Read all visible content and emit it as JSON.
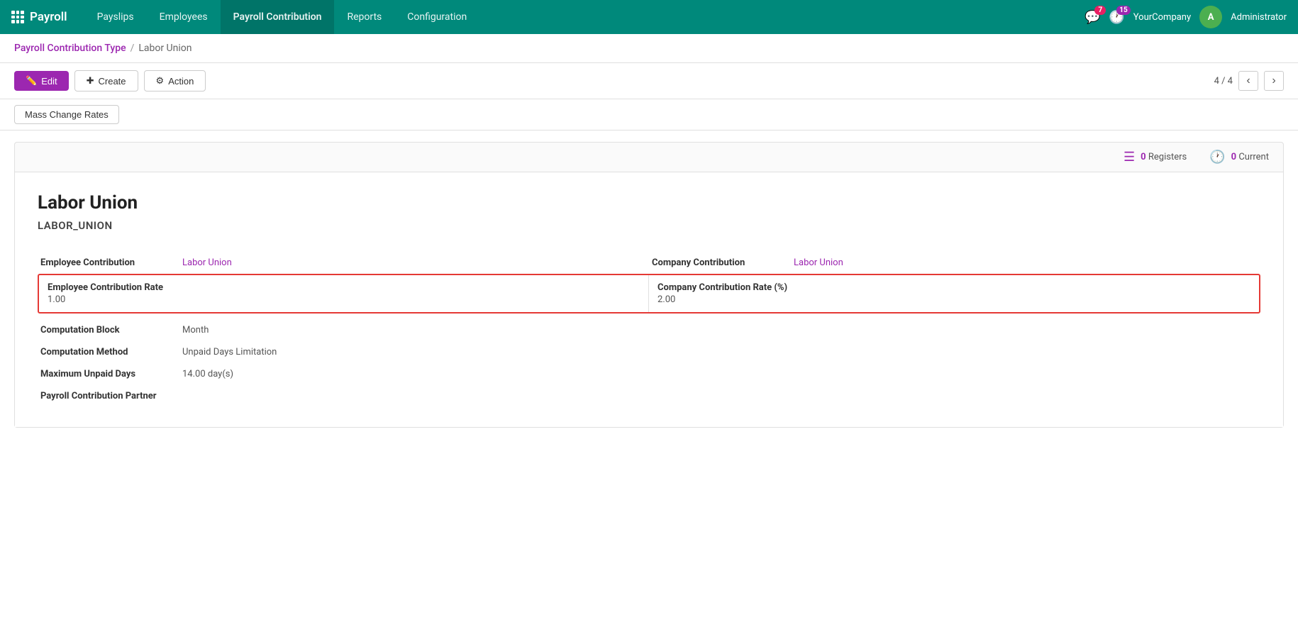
{
  "app": {
    "logo_label": "Payroll",
    "grid_icon": "grid-icon"
  },
  "topnav": {
    "menu_items": [
      {
        "label": "Payslips",
        "active": false
      },
      {
        "label": "Employees",
        "active": false
      },
      {
        "label": "Payroll Contribution",
        "active": true
      },
      {
        "label": "Reports",
        "active": false
      },
      {
        "label": "Configuration",
        "active": false
      }
    ],
    "notif1_count": "7",
    "notif2_count": "15",
    "company": "YourCompany",
    "user_initial": "A",
    "user_name": "Administrator"
  },
  "breadcrumb": {
    "parent_label": "Payroll Contribution Type",
    "separator": "/",
    "current_label": "Labor Union"
  },
  "toolbar": {
    "edit_label": "Edit",
    "create_label": "Create",
    "action_label": "Action",
    "pagination_text": "4 / 4"
  },
  "sub_toolbar": {
    "mass_change_label": "Mass Change Rates"
  },
  "stats": {
    "registers_count": "0",
    "registers_label": "Registers",
    "current_count": "0",
    "current_label": "Current"
  },
  "record": {
    "title": "Labor Union",
    "code": "LABOR_UNION"
  },
  "fields": {
    "employee_contribution_label": "Employee Contribution",
    "employee_contribution_value": "Labor Union",
    "company_contribution_label": "Company Contribution",
    "company_contribution_value": "Labor Union",
    "employee_rate_label": "Employee Contribution Rate",
    "employee_rate_value": "1.00",
    "company_rate_label": "Company Contribution Rate (%)",
    "company_rate_value": "2.00",
    "computation_block_label": "Computation Block",
    "computation_block_value": "Month",
    "computation_method_label": "Computation Method",
    "computation_method_value": "Unpaid Days Limitation",
    "max_unpaid_label": "Maximum Unpaid Days",
    "max_unpaid_value": "14.00 day(s)",
    "payroll_partner_label": "Payroll Contribution Partner",
    "payroll_partner_value": ""
  }
}
